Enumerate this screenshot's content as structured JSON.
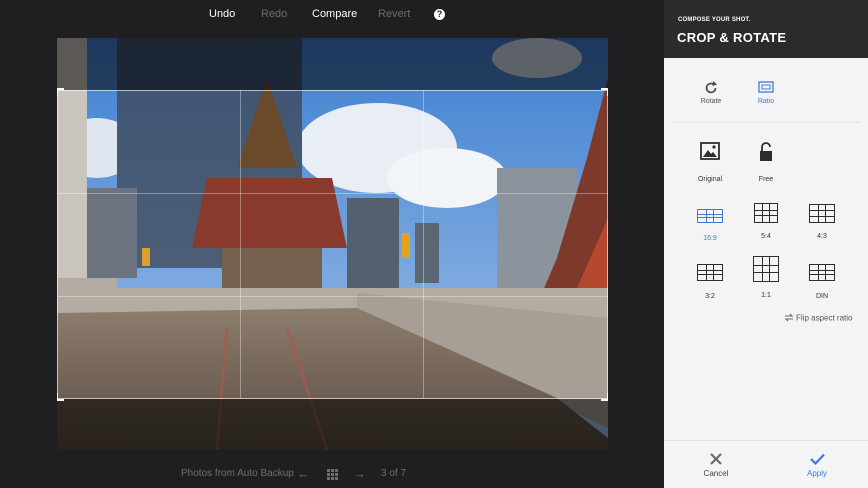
{
  "toolbar": {
    "undo": "Undo",
    "redo": "Redo",
    "compare": "Compare",
    "revert": "Revert",
    "help_icon": "?"
  },
  "bottom_nav": {
    "album": "Photos from Auto Backup",
    "counter": "3 of 7",
    "prev_icon": "←",
    "grid_icon": "grid",
    "next_icon": "→"
  },
  "panel": {
    "subtitle": "COMPOSE YOUR SHOT.",
    "title": "CROP & ROTATE",
    "modes": [
      {
        "label": "Rotate",
        "icon": "rotate-icon",
        "active": false
      },
      {
        "label": "Ratio",
        "icon": "ratio-icon",
        "active": true
      }
    ],
    "options": [
      {
        "label": "Original",
        "icon": "image-icon"
      },
      {
        "label": "Free",
        "icon": "unlock-icon"
      }
    ],
    "ratios": [
      {
        "label": "16:9",
        "active": true
      },
      {
        "label": "5:4",
        "active": false
      },
      {
        "label": "4:3",
        "active": false
      },
      {
        "label": "3:2",
        "active": false
      },
      {
        "label": "1:1",
        "active": false
      },
      {
        "label": "DIN",
        "active": false
      }
    ],
    "flip_label": "Flip aspect ratio",
    "cancel": "Cancel",
    "apply": "Apply"
  },
  "colors": {
    "accent": "#3d7cd6",
    "panel_header": "#2b2b2e",
    "editor_bg": "#1f1f21"
  }
}
